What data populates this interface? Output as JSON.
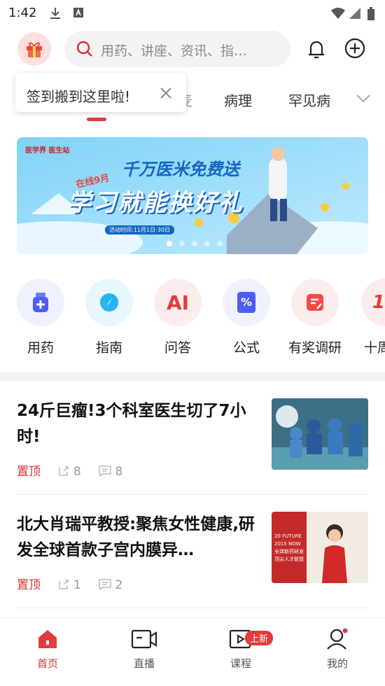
{
  "status_bar": {
    "time": "1:42"
  },
  "header": {
    "search_placeholder": "用药、讲座、资讯、指…"
  },
  "tooltip": {
    "text": "签到搬到这里啦!"
  },
  "tabs": [
    "病理",
    "罕见病"
  ],
  "banner": {
    "logos": "医学界  医生站",
    "headline_small": "千万医米免费送",
    "headline_big": "学习就能换好礼",
    "ribbon": "在线9月",
    "date_note": "活动时间:11月1日-30日"
  },
  "features": [
    {
      "label": "用药",
      "icon": "medicine-bottle-icon"
    },
    {
      "label": "指南",
      "icon": "compass-icon"
    },
    {
      "label": "问答",
      "icon": "ai-icon",
      "glyph": "AI"
    },
    {
      "label": "公式",
      "icon": "formula-icon",
      "glyph": "%"
    },
    {
      "label": "有奖调研",
      "icon": "survey-icon"
    },
    {
      "label": "十周",
      "icon": "anniversary-icon"
    }
  ],
  "articles": [
    {
      "title": "24斤巨瘤!3个科室医生切了7小时!",
      "pinned": "置顶",
      "shares": "8",
      "comments": "8"
    },
    {
      "title": "北大肖瑞平教授:聚焦女性健康,研发全球首款子宫内膜异…",
      "pinned": "置顶",
      "shares": "1",
      "comments": "2",
      "thumb_text": "20 FUTURE 2015 NOW 全球新药研发 顶尖人才联盟"
    }
  ],
  "bottom_nav": [
    {
      "label": "首页",
      "active": true
    },
    {
      "label": "直播"
    },
    {
      "label": "课程",
      "badge": "上新"
    },
    {
      "label": "我的"
    }
  ],
  "colors": {
    "accent": "#d23333"
  }
}
